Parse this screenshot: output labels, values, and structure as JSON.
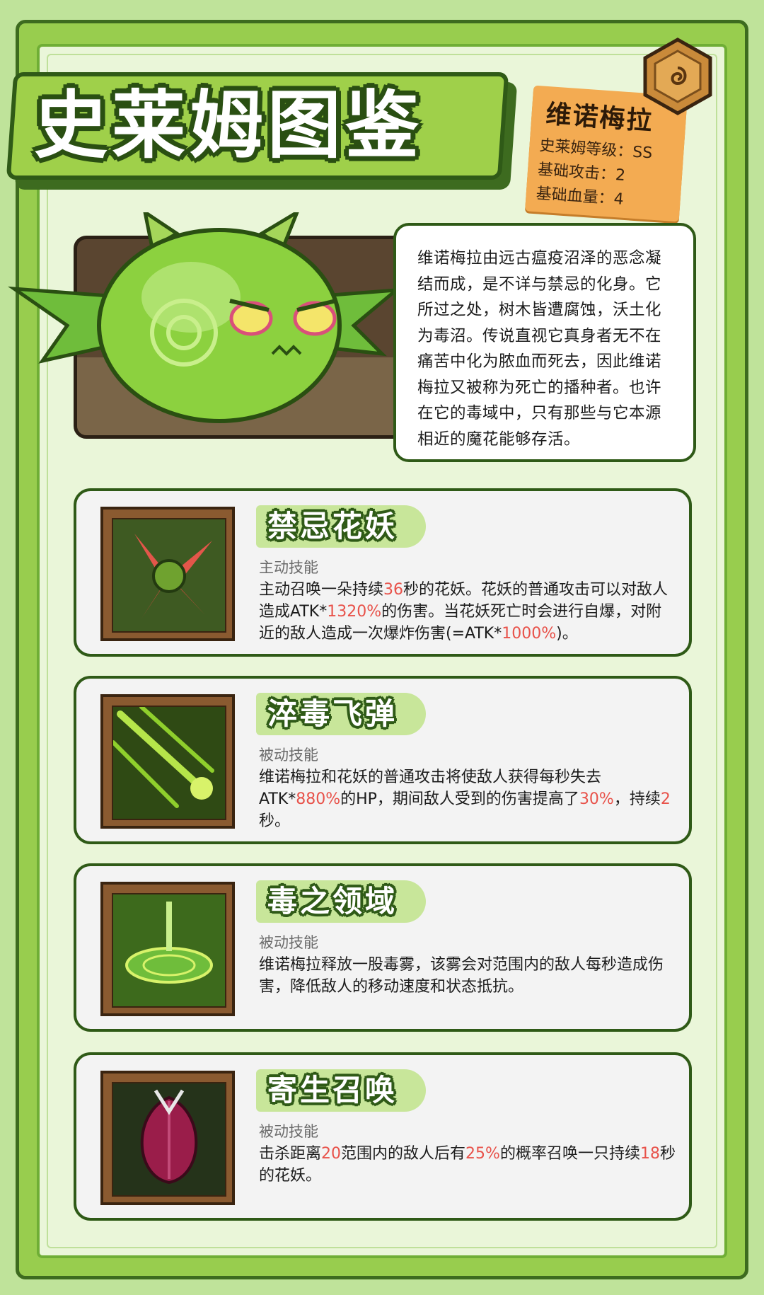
{
  "page_title": "史莱姆图鉴",
  "info_tag": {
    "name": "维诺梅拉",
    "grade": "史莱姆等级：SS",
    "attack": "基础攻击：2",
    "health": "基础血量：4"
  },
  "description": "维诺梅拉由远古瘟疫沼泽的恶念凝结而成，是不详与禁忌的化身。它所过之处，树木皆遭腐蚀，沃土化为毒沼。传说直视它真身者无不在痛苦中化为脓血而死去，因此维诺梅拉又被称为死亡的播种者。也许在它的毒域中，只有那些与它本源相近的魔花能够存活。",
  "skills": [
    {
      "name": "禁忌花妖",
      "type": "主动技能",
      "desc": [
        {
          "t": "主动召唤一朵持续"
        },
        {
          "t": "36",
          "hl": true
        },
        {
          "t": "秒的花妖。花妖的普通攻击可以对敌人造成ATK*"
        },
        {
          "t": "1320%",
          "hl": true
        },
        {
          "t": "的伤害。当花妖死亡时会进行自爆，对附近的敌人造成一次爆炸伤害(=ATK*"
        },
        {
          "t": "1000%",
          "hl": true
        },
        {
          "t": ")。"
        }
      ]
    },
    {
      "name": "淬毒飞弹",
      "type": "被动技能",
      "desc": [
        {
          "t": "维诺梅拉和花妖的普通攻击将使敌人获得每秒失去ATK*"
        },
        {
          "t": "880%",
          "hl": true
        },
        {
          "t": "的HP，期间敌人受到的伤害提高了"
        },
        {
          "t": "30%",
          "hl": true
        },
        {
          "t": "，持续"
        },
        {
          "t": "2",
          "hl": true
        },
        {
          "t": "秒。"
        }
      ]
    },
    {
      "name": "毒之领域",
      "type": "被动技能",
      "desc": [
        {
          "t": "维诺梅拉释放一股毒雾，该雾会对范围内的敌人每秒造成伤害，降低敌人的移动速度和状态抵抗。"
        }
      ]
    },
    {
      "name": "寄生召唤",
      "type": "被动技能",
      "desc": [
        {
          "t": "击杀距离"
        },
        {
          "t": "20",
          "hl": true
        },
        {
          "t": "范围内的敌人后有"
        },
        {
          "t": "25%",
          "hl": true
        },
        {
          "t": "的概率召唤一只持续"
        },
        {
          "t": "18",
          "hl": true
        },
        {
          "t": "秒的花妖。"
        }
      ]
    }
  ],
  "icons": [
    "rune-gem-icon",
    "slime-portrait",
    "flower-demon-icon",
    "poison-missile-icon",
    "poison-field-icon",
    "parasite-bud-icon"
  ],
  "colors": {
    "accent": "#e8524a",
    "frame_green": "#2f5a17",
    "tag_orange": "#f3ab52"
  }
}
